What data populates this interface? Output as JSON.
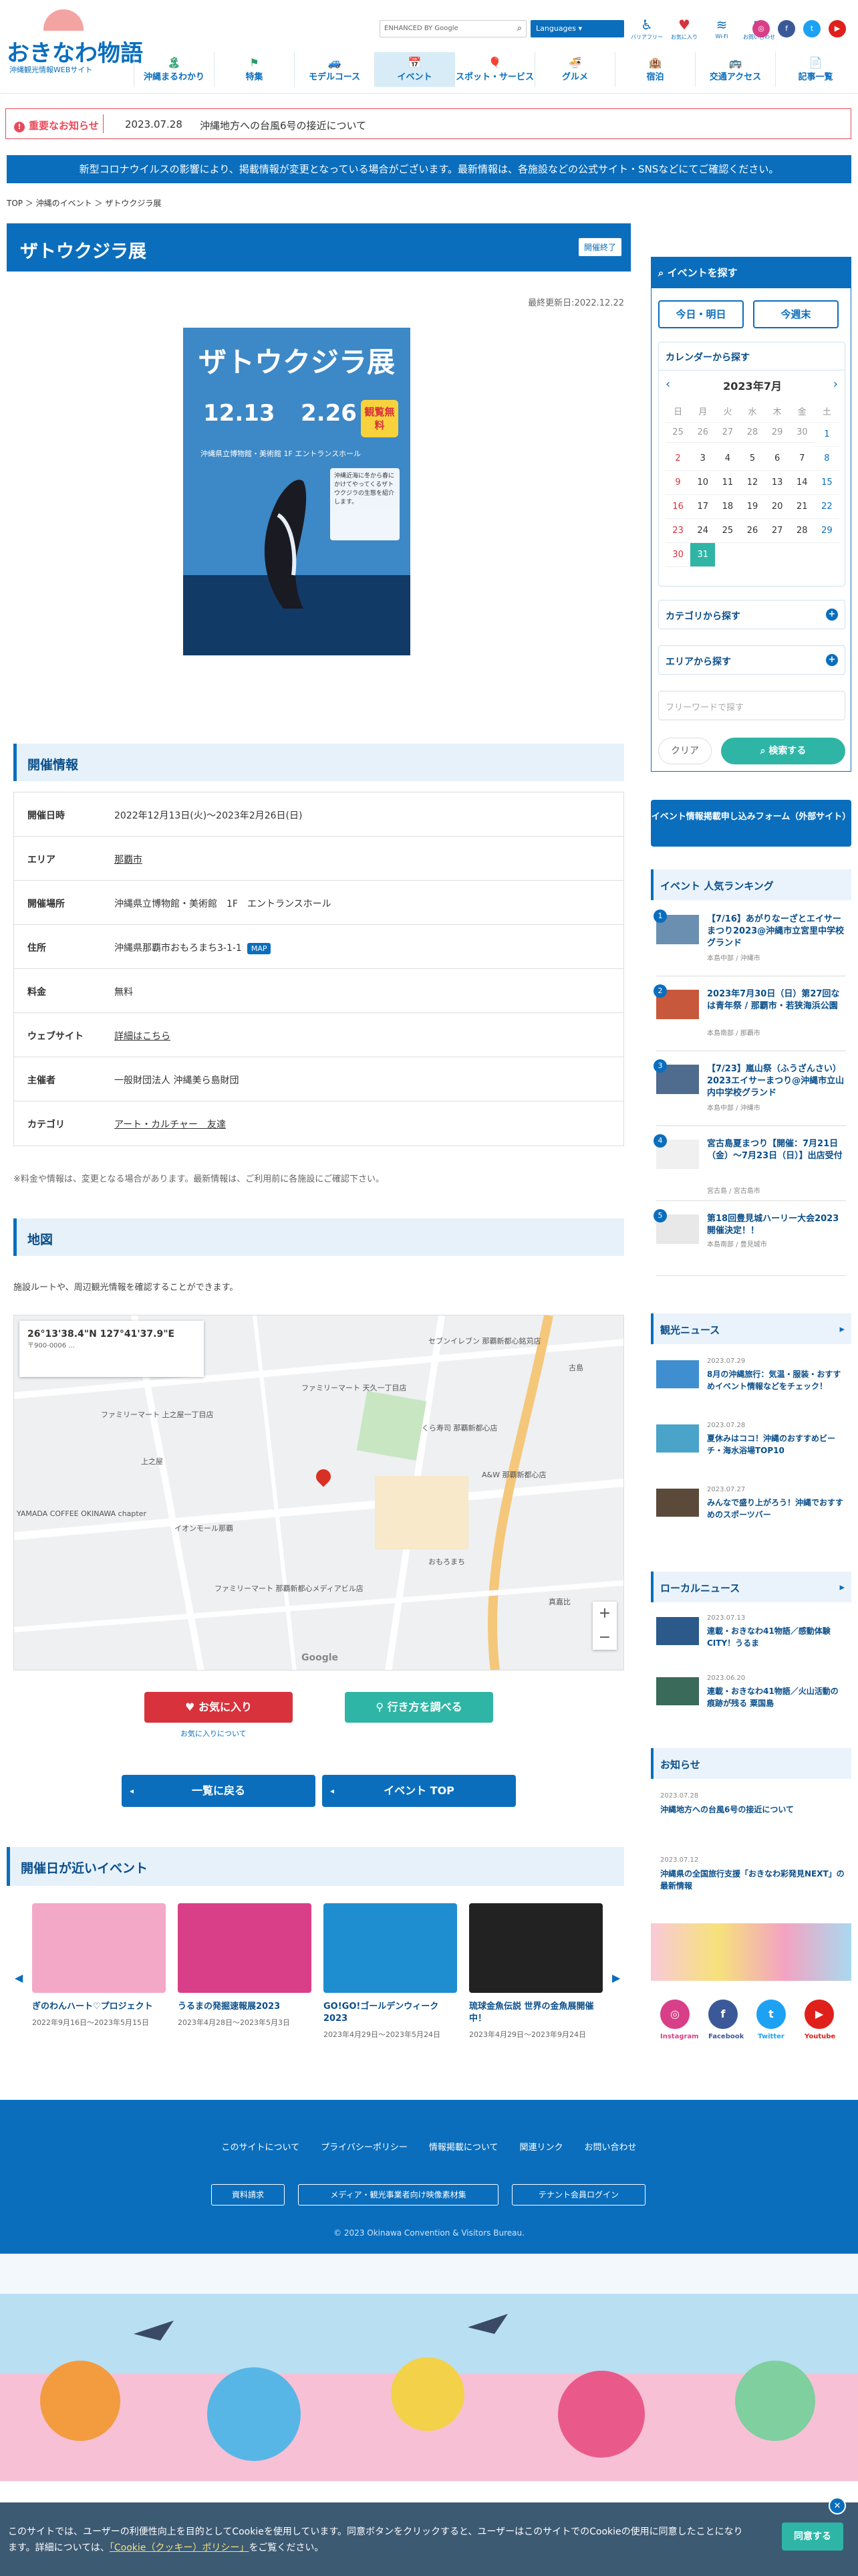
{
  "header": {
    "logo_title": "おきなわ物語",
    "logo_sub": "沖縄観光情報WEBサイト",
    "search_placeholder": "ENHANCED BY Google",
    "language_label": "Languages",
    "top_icons": [
      {
        "label": "バリアフリー",
        "icon": "accessibility-icon"
      },
      {
        "label": "お気に入り",
        "icon": "heart-icon"
      },
      {
        "label": "Wi-Fi",
        "icon": "wifi-icon"
      },
      {
        "label": "お問い合わせ",
        "icon": "mail-icon"
      }
    ],
    "nav": [
      {
        "label": "沖縄まるわかり",
        "icon": "🏝"
      },
      {
        "label": "特集",
        "icon": "⚑"
      },
      {
        "label": "モデルコース",
        "icon": "🚙"
      },
      {
        "label": "イベント",
        "icon": "📅"
      },
      {
        "label": "スポット・サービス",
        "icon": "🎈"
      },
      {
        "label": "グルメ",
        "icon": "🍜"
      },
      {
        "label": "宿泊",
        "icon": "🏨"
      },
      {
        "label": "交通アクセス",
        "icon": "🚌"
      },
      {
        "label": "記事一覧",
        "icon": "📄"
      }
    ]
  },
  "alert": {
    "label": "重要なお知らせ",
    "date": "2023.07.28",
    "message": "沖縄地方への台風6号の接近について"
  },
  "corona": "新型コロナウイルスの影響により、掲載情報が変更となっている場合がございます。最新情報は、各施設などの公式サイト・SNSなどにてご確認ください。",
  "breadcrumb": [
    "TOP",
    "沖縄のイベント",
    "ザトウクジラ展"
  ],
  "event": {
    "title": "ザトウクジラ展",
    "badge": "開催終了",
    "updated": "最終更新日:2022.12.22",
    "poster": {
      "title": "ザトウクジラ展",
      "date1": "12.13",
      "date2": "2.26",
      "free": "観覧無料",
      "venue": "沖縄県立博物館・美術館 1F エントランスホール"
    }
  },
  "info": {
    "heading": "開催情報",
    "rows": [
      {
        "k": "開催日時",
        "v": "2022年12月13日(火)〜2023年2月26日(日)"
      },
      {
        "k": "エリア",
        "v": "那覇市",
        "link": true
      },
      {
        "k": "開催場所",
        "v": "沖縄県立博物館・美術館　1F　エントランスホール"
      },
      {
        "k": "住所",
        "v": "沖縄県那覇市おもろまち3-1-1",
        "map": "MAP"
      },
      {
        "k": "料金",
        "v": "無料"
      },
      {
        "k": "ウェブサイト",
        "v": "詳細はこちら",
        "link": true
      },
      {
        "k": "主催者",
        "v": "一般財団法人 沖縄美ら島財団"
      },
      {
        "k": "カテゴリ",
        "v": "アート・カルチャー　友達",
        "link": true
      }
    ],
    "note": "※料金や情報は、変更となる場合があります。最新情報は、ご利用前に各施設にご確認下さい。"
  },
  "mapsec": {
    "heading": "地図",
    "desc": "施設ルートや、周辺観光情報を確認することができます。",
    "coord": "26°13'38.4\"N 127°41'37.9\"E",
    "postal": "〒900-0006 ...",
    "labels": [
      "セブンイレブン 那覇新都心銘苅店",
      "ファミリーマート 上之屋一丁目店",
      "ファミリーマート 天久一丁目店",
      "くら寿司 那覇新都心店",
      "イオンモール那覇",
      "A&W 那覇新都心店",
      "おもろまち",
      "YAMADA COFFEE OKINAWA chapter",
      "ファミリーマート 那覇新都心メディアビル店",
      "古島",
      "上之屋",
      "真嘉比"
    ]
  },
  "actions": {
    "favorite": "お気に入り",
    "route": "行き方を調べる",
    "fav_about": "お気に入りについて",
    "back": "一覧に戻る",
    "top": "イベント TOP"
  },
  "near": {
    "heading": "開催日が近いイベント",
    "cards": [
      {
        "title": "ぎのわんハート♡プロジェクト",
        "date": "2022年9月16日〜2023年5月15日",
        "color": "#f4a8c8"
      },
      {
        "title": "うるまの発掘速報展2023",
        "date": "2023年4月28日〜2023年5月3日",
        "color": "#d83f88"
      },
      {
        "title": "GO!GO!ゴールデンウィーク2023",
        "date": "2023年4月29日〜2023年5月24日",
        "color": "#1f8ed0"
      },
      {
        "title": "琉球金魚伝説 世界の金魚展開催中！",
        "date": "2023年4月29日〜2023年9月24日",
        "color": "#222222"
      }
    ]
  },
  "sidebar": {
    "search_head": "イベントを探す",
    "today": "今日・明日",
    "weekend": "今週末",
    "cal_head": "カレンダーから探す",
    "month": "2023年7月",
    "weekdays": [
      "日",
      "月",
      "火",
      "水",
      "木",
      "金",
      "土"
    ],
    "days": [
      "25",
      "26",
      "27",
      "28",
      "29",
      "30",
      "1",
      "2",
      "3",
      "4",
      "5",
      "6",
      "7",
      "8",
      "9",
      "10",
      "11",
      "12",
      "13",
      "14",
      "15",
      "16",
      "17",
      "18",
      "19",
      "20",
      "21",
      "22",
      "23",
      "24",
      "25",
      "26",
      "27",
      "28",
      "29",
      "30",
      "31",
      "",
      "",
      "",
      "",
      ""
    ],
    "cat_head": "カテゴリから探す",
    "area_head": "エリアから探す",
    "keyword_placeholder": "フリーワードで探す",
    "clear": "クリア",
    "search": "検索する",
    "form": "イベント情報掲載申し込みフォーム（外部サイト）",
    "rank_head": "イベント 人気ランキング",
    "ranking": [
      {
        "t": "【7/16】あがりなーざとエイサーまつり2023@沖縄市立宮里中学校グランド",
        "s": "本島中部 / 沖縄市"
      },
      {
        "t": "2023年7月30日（日）第27回なは青年祭 / 那覇市・若狭海浜公園",
        "s": "本島南部 / 那覇市"
      },
      {
        "t": "【7/23】嵐山祭（ふうざんさい）2023エイサーまつり@沖縄市立山内中学校グランド",
        "s": "本島中部 / 沖縄市"
      },
      {
        "t": "宮古島夏まつり【開催：7月21日（金）〜7月23日（日）】出店受付",
        "s": "宮古島 / 宮古島市"
      },
      {
        "t": "第18回豊見城ハーリー大会2023開催決定！！",
        "s": "本島南部 / 豊見城市"
      }
    ],
    "news_head": "観光ニュース",
    "news": [
      {
        "d": "2023.07.29",
        "t": "8月の沖縄旅行：気温・服装・おすすめイベント情報などをチェック！"
      },
      {
        "d": "2023.07.28",
        "t": "夏休みはココ！沖縄のおすすめビーチ・海水浴場TOP10"
      },
      {
        "d": "2023.07.27",
        "t": "みんなで盛り上がろう！沖縄でおすすめのスポーツバー"
      }
    ],
    "local_head": "ローカルニュース",
    "local": [
      {
        "d": "2023.07.13",
        "t": "連載・おきなわ41物語／感動体験CITY！うるま"
      },
      {
        "d": "2023.06.20",
        "t": "連載・おきなわ41物語／火山活動の痕跡が残る 粟国島"
      }
    ],
    "notice_head": "お知らせ",
    "notices": [
      {
        "d": "2023.07.28",
        "t": "沖縄地方への台風6号の接近について"
      },
      {
        "d": "2023.07.12",
        "t": "沖縄県の全国旅行支援「おきなわ彩発見NEXT」の最新情報"
      }
    ],
    "sns": [
      {
        "label": "Instagram",
        "color": "#d83f88",
        "glyph": "◎"
      },
      {
        "label": "Facebook",
        "color": "#3b5998",
        "glyph": "f"
      },
      {
        "label": "Twitter",
        "color": "#1da1f2",
        "glyph": "t"
      },
      {
        "label": "Youtube",
        "color": "#e0201a",
        "glyph": "▶"
      }
    ]
  },
  "footer": {
    "links": [
      "このサイトについて",
      "プライバシーポリシー",
      "情報掲載について",
      "関連リンク",
      "お問い合わせ"
    ],
    "buttons": [
      "資料請求",
      "メディア・観光事業者向け映像素材集",
      "テナント会員ログイン"
    ],
    "copyright": "© 2023 Okinawa Convention & Visitors Bureau."
  },
  "cookie": {
    "text": "このサイトでは、ユーザーの利便性向上を目的としてCookieを使用しています。同意ボタンをクリックすると、ユーザーはこのサイトでのCookieの使用に同意したことになります。詳細については、",
    "link": "「Cookie（クッキー）ポリシー」",
    "tail": "をご覧ください。",
    "agree": "同意する"
  }
}
